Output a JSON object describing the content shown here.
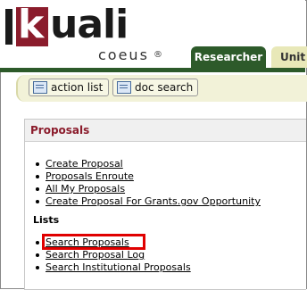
{
  "header": {
    "logo_main": "kuali",
    "logo_k": "k",
    "logo_rest": "uali",
    "logo_sub": "coeus",
    "logo_reg": "®",
    "tabs": [
      {
        "label": "Researcher",
        "active": true
      },
      {
        "label": "Unit",
        "active": false
      }
    ],
    "accent_color": "#2d5a2a",
    "brand_color": "#8b1c2c"
  },
  "toolbar": {
    "action_list_label": "action list",
    "doc_search_label": "doc search"
  },
  "proposals": {
    "title": "Proposals",
    "links": [
      "Create Proposal",
      "Proposals Enroute",
      "All My Proposals",
      "Create Proposal For Grants.gov Opportunity"
    ],
    "lists_title": "Lists",
    "list_links": [
      "Search Proposals",
      "Search Proposal Log",
      "Search Institutional Proposals"
    ],
    "highlighted_link": "Search Proposals"
  }
}
